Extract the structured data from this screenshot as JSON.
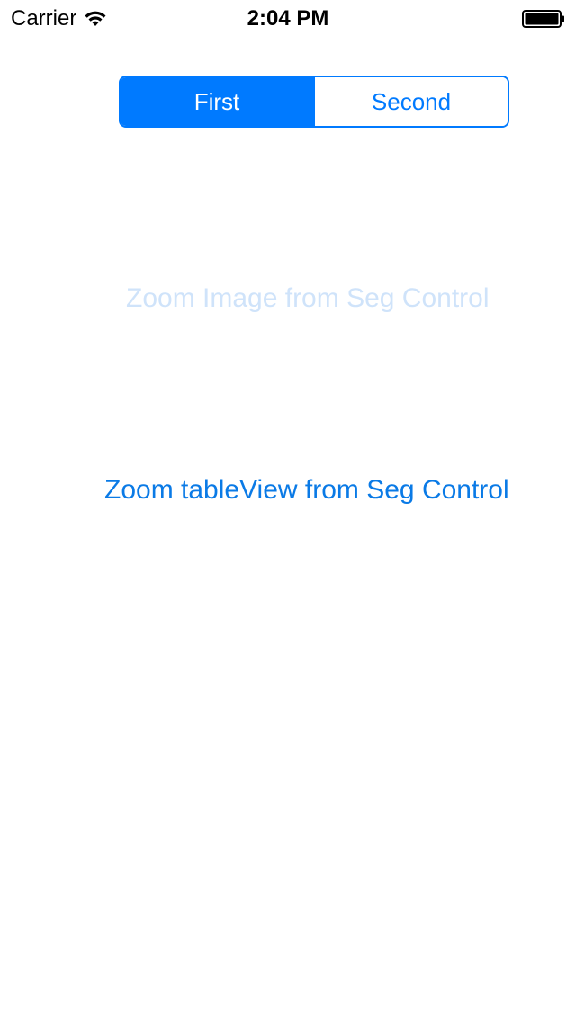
{
  "status_bar": {
    "carrier": "Carrier",
    "time": "2:04 PM",
    "wifi_icon": "wifi-icon",
    "battery_icon": "battery-icon"
  },
  "segmented_control": {
    "segments": [
      {
        "label": "First",
        "selected": true
      },
      {
        "label": "Second",
        "selected": false
      }
    ],
    "accent_color": "#007aff"
  },
  "buttons": {
    "zoom_image": {
      "label": "Zoom Image from Seg Control",
      "enabled": false,
      "color": "#cfe3fa"
    },
    "zoom_table": {
      "label": "Zoom tableView from Seg Control",
      "enabled": true,
      "color": "#0a7ae6"
    }
  }
}
